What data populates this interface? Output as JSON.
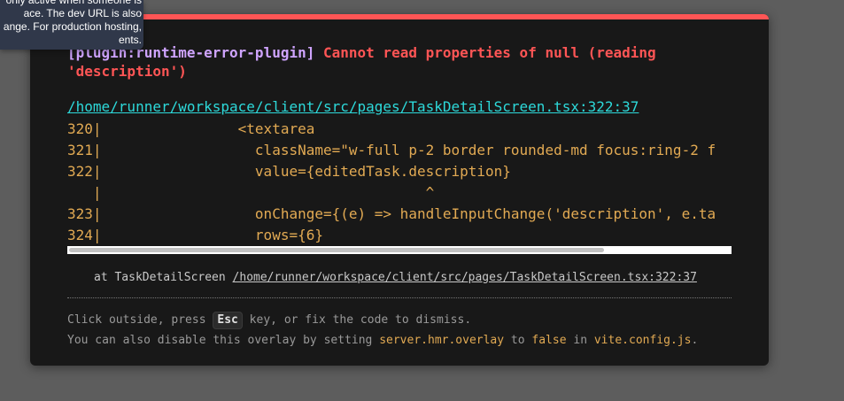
{
  "tooltip": {
    "lines": [
      "only active when someone is",
      "ace. The dev URL is also",
      "ange. For production hosting,",
      "ents."
    ]
  },
  "error": {
    "plugin": "[plugin:runtime-error-plugin]",
    "message": "Cannot read properties of null (reading 'description')",
    "file": "/home/runner/workspace/client/src/pages/TaskDetailScreen.tsx:322:37",
    "frame": [
      "320|                <textarea",
      "321|                  className=\"w-full p-2 border rounded-md focus:ring-2 f",
      "322|                  value={editedTask.description}",
      "   |                                      ^",
      "323|                  onChange={(e) => handleInputChange('description', e.ta",
      "324|                  rows={6}"
    ],
    "stack": {
      "prefix": "at TaskDetailScreen ",
      "link": "/home/runner/workspace/client/src/pages/TaskDetailScreen.tsx:322:37"
    }
  },
  "tips": {
    "line1_a": "Click outside, press ",
    "key": "Esc",
    "line1_b": " key, or fix the code to dismiss.",
    "line2_a": "You can also disable this overlay by setting ",
    "line2_code1": "server.hmr.overlay",
    "line2_b": " to ",
    "line2_code2": "false",
    "line2_c": " in ",
    "line2_code3": "vite.config.js",
    "line2_d": "."
  },
  "colors": {
    "accent_red": "#ff5555",
    "plugin_purple": "#cfa4ff",
    "link_cyan": "#2dd9da",
    "code_orange": "#e2aa53"
  }
}
